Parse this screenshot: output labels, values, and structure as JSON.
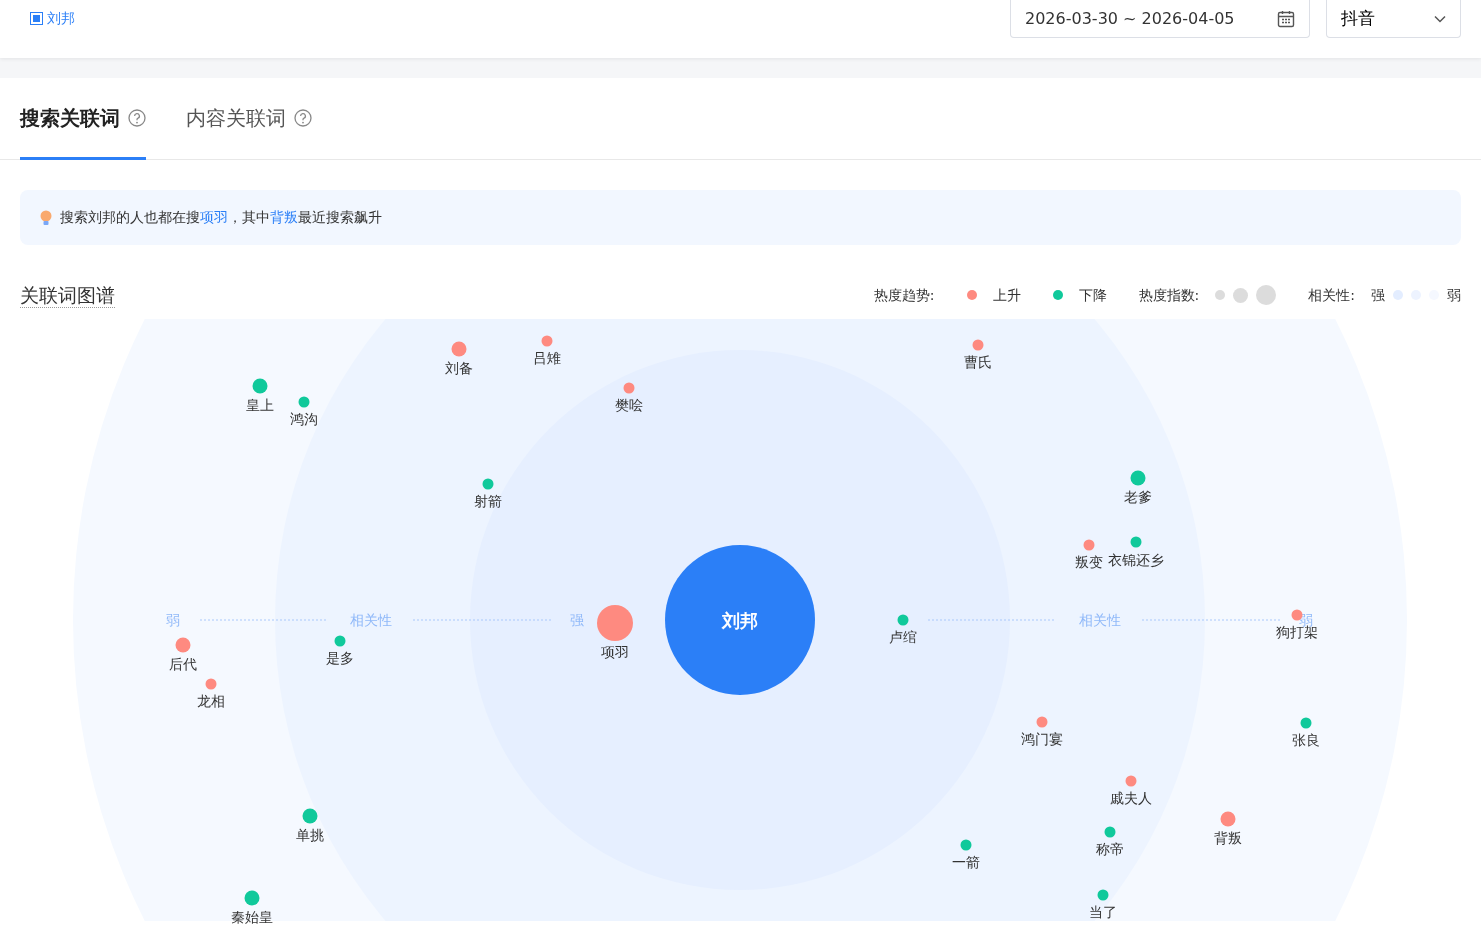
{
  "topbar": {
    "keyword": "刘邦",
    "date_range": "2026-03-30 ~ 2026-04-05",
    "platform": "抖音"
  },
  "tabs": [
    {
      "label": "搜索关联词",
      "selected": true
    },
    {
      "label": "内容关联词",
      "selected": false
    }
  ],
  "insight": [
    {
      "kind": "plain",
      "text": "搜索刘邦的人也都在搜"
    },
    {
      "kind": "link",
      "text": "项羽"
    },
    {
      "kind": "plain",
      "text": "，其中"
    },
    {
      "kind": "link",
      "text": "背叛"
    },
    {
      "kind": "plain",
      "text": "最近搜索飙升"
    }
  ],
  "graph": {
    "title": "关联词图谱",
    "legend": {
      "trend_label": "热度趋势:",
      "trends": [
        {
          "label": "上升",
          "color": "#fe8a80"
        },
        {
          "label": "下降",
          "color": "#10c99b"
        }
      ],
      "heat_label": "热度指数:",
      "relevance_label": "相关性:",
      "relevance_strong": "强",
      "relevance_weak": "弱"
    },
    "center": "刘邦",
    "axis_left": [
      "弱",
      "相关性",
      "强"
    ],
    "axis_right": [
      "相关性",
      "弱"
    ],
    "nodes": [
      {
        "label": "刘备",
        "rising": true
      },
      {
        "label": "吕雉",
        "rising": true
      },
      {
        "label": "曹氏",
        "rising": true
      },
      {
        "label": "皇上",
        "rising": false
      },
      {
        "label": "鸿沟",
        "rising": false
      },
      {
        "label": "樊哙",
        "rising": true
      },
      {
        "label": "射箭",
        "rising": false
      },
      {
        "label": "老爹",
        "rising": false
      },
      {
        "label": "叛变",
        "rising": true
      },
      {
        "label": "衣锦还乡",
        "rising": false
      },
      {
        "label": "项羽",
        "rising": true
      },
      {
        "label": "卢绾",
        "rising": false
      },
      {
        "label": "狗打架",
        "rising": true
      },
      {
        "label": "后代",
        "rising": true
      },
      {
        "label": "是多",
        "rising": false
      },
      {
        "label": "龙相",
        "rising": true
      },
      {
        "label": "鸿门宴",
        "rising": true
      },
      {
        "label": "张良",
        "rising": false
      },
      {
        "label": "戚夫人",
        "rising": true
      },
      {
        "label": "背叛",
        "rising": true
      },
      {
        "label": "单挑",
        "rising": false
      },
      {
        "label": "称帝",
        "rising": false
      },
      {
        "label": "一箭",
        "rising": false
      },
      {
        "label": "秦始皇",
        "rising": false
      },
      {
        "label": "当了",
        "rising": false
      }
    ]
  }
}
